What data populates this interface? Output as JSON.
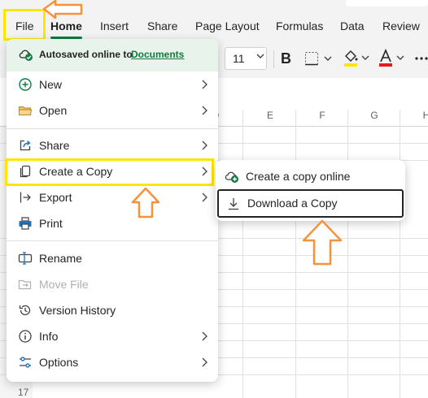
{
  "ribbon": {
    "tabs": [
      {
        "label": "File"
      },
      {
        "label": "Home"
      },
      {
        "label": "Insert"
      },
      {
        "label": "Share"
      },
      {
        "label": "Page Layout"
      },
      {
        "label": "Formulas"
      },
      {
        "label": "Data"
      },
      {
        "label": "Review"
      }
    ],
    "font_size": "11",
    "bold_label": "B"
  },
  "sheet": {
    "columns": [
      "D",
      "E",
      "F",
      "G",
      "H"
    ],
    "visible_row_number": "17"
  },
  "file_menu": {
    "autosave_text": "Autosaved online to",
    "autosave_link": "Documents",
    "items": [
      {
        "label": "New",
        "icon": "plus-circle-icon",
        "submenu": true
      },
      {
        "label": "Open",
        "icon": "folder-icon",
        "submenu": true
      },
      {
        "label": "Share",
        "icon": "share-icon",
        "submenu": true
      },
      {
        "label": "Create a Copy",
        "icon": "copy-icon",
        "submenu": true
      },
      {
        "label": "Export",
        "icon": "export-icon",
        "submenu": true
      },
      {
        "label": "Print",
        "icon": "printer-icon",
        "submenu": false
      },
      {
        "label": "Rename",
        "icon": "rename-icon",
        "submenu": false
      },
      {
        "label": "Move File",
        "icon": "move-file-icon",
        "submenu": false,
        "disabled": true
      },
      {
        "label": "Version History",
        "icon": "history-icon",
        "submenu": false
      },
      {
        "label": "Info",
        "icon": "info-icon",
        "submenu": true
      },
      {
        "label": "Options",
        "icon": "settings-sliders-icon",
        "submenu": true
      }
    ]
  },
  "copy_submenu": {
    "items": [
      {
        "label": "Create a copy online",
        "icon": "cloud-add-icon"
      },
      {
        "label": "Download a Copy",
        "icon": "download-icon",
        "active": true
      }
    ]
  },
  "colors": {
    "accent_green": "#0f7b3f",
    "highlight_yellow": "#ffe500",
    "callout_orange": "#f7923a"
  }
}
